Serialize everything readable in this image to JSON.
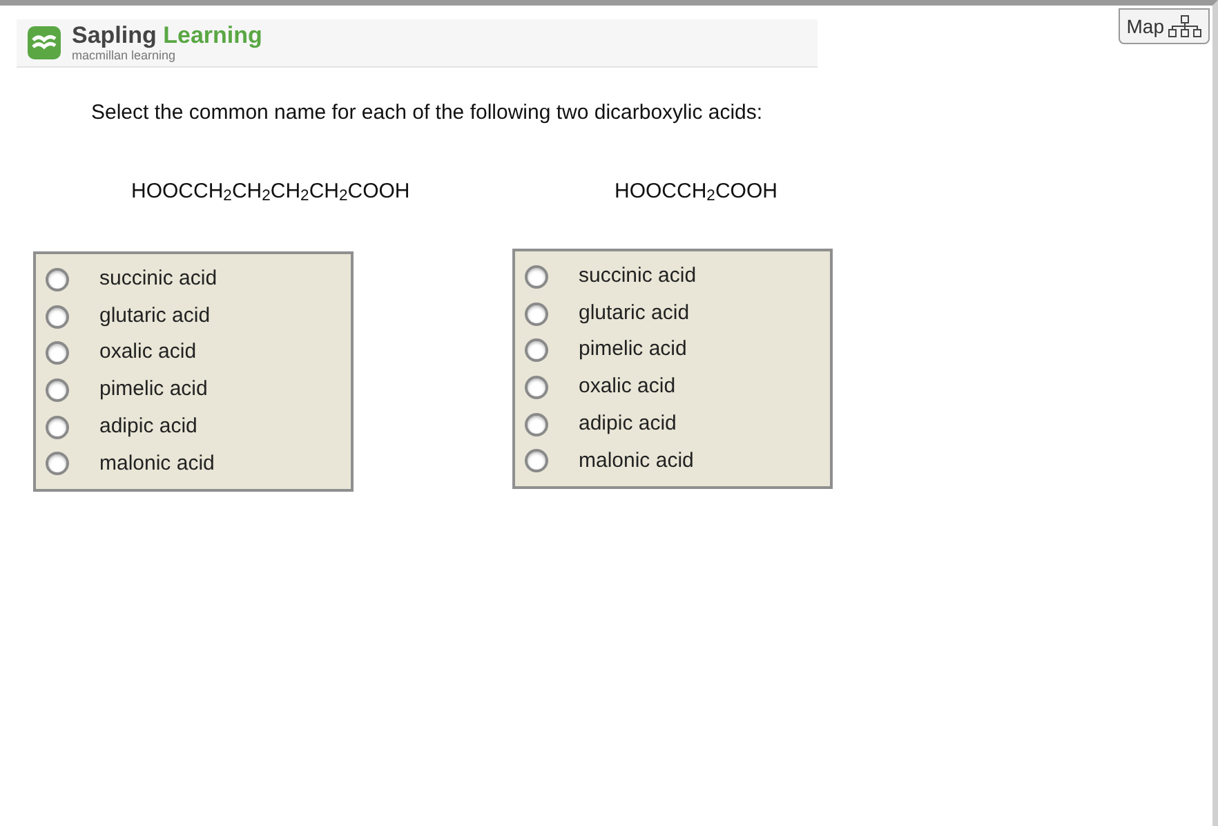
{
  "header": {
    "brand_primary": "Sapling",
    "brand_secondary": "Learning",
    "tagline": "macmillan learning"
  },
  "map_button": {
    "label": "Map"
  },
  "question": "Select the common name for each of the following two dicarboxylic acids:",
  "parts": [
    {
      "formula": "HOOCCH$_{2}$CH$_{2}$CH$_{2}$CH$_{2}$COOH",
      "options": [
        {
          "label": "succinic acid",
          "selected": false
        },
        {
          "label": "glutaric acid",
          "selected": false
        },
        {
          "label": "oxalic acid",
          "selected": false
        },
        {
          "label": "pimelic acid",
          "selected": false
        },
        {
          "label": "adipic acid",
          "selected": false
        },
        {
          "label": "malonic acid",
          "selected": false
        }
      ]
    },
    {
      "formula": "HOOCCH$_{2}$COOH",
      "options": [
        {
          "label": "succinic acid",
          "selected": false
        },
        {
          "label": "glutaric acid",
          "selected": false
        },
        {
          "label": "pimelic acid",
          "selected": false
        },
        {
          "label": "oxalic acid",
          "selected": false
        },
        {
          "label": "adipic acid",
          "selected": false
        },
        {
          "label": "malonic acid",
          "selected": false
        }
      ]
    }
  ]
}
